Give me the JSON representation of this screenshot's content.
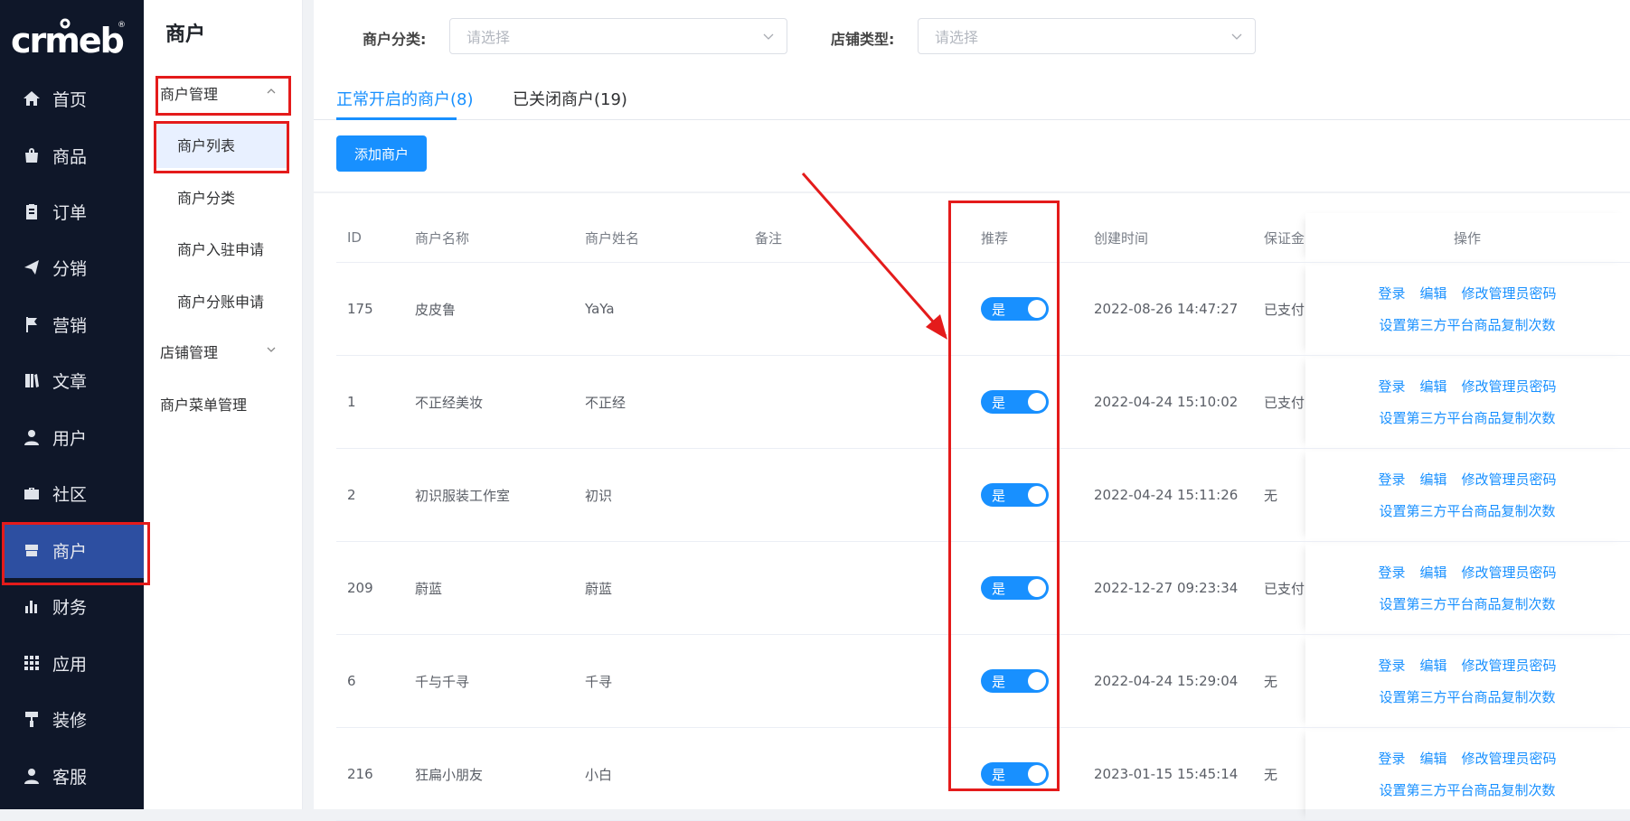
{
  "brand": {
    "logo_text": "crmeb"
  },
  "sidebar": {
    "items": [
      {
        "label": "首页",
        "icon": "home-icon"
      },
      {
        "label": "商品",
        "icon": "bag-icon"
      },
      {
        "label": "订单",
        "icon": "clipboard-icon"
      },
      {
        "label": "分销",
        "icon": "send-icon"
      },
      {
        "label": "营销",
        "icon": "flag-icon"
      },
      {
        "label": "文章",
        "icon": "book-icon"
      },
      {
        "label": "用户",
        "icon": "user-icon"
      },
      {
        "label": "社区",
        "icon": "briefcase-icon"
      },
      {
        "label": "商户",
        "icon": "store-icon",
        "active": true
      },
      {
        "label": "财务",
        "icon": "bar-chart-icon"
      },
      {
        "label": "应用",
        "icon": "grid-icon"
      },
      {
        "label": "装修",
        "icon": "paint-roller-icon"
      },
      {
        "label": "客服",
        "icon": "user-icon"
      }
    ]
  },
  "submenu": {
    "title": "商户",
    "group1": "商户管理",
    "items": [
      "商户列表",
      "商户分类",
      "商户入驻申请",
      "商户分账申请"
    ],
    "group2": "店铺管理",
    "item_menu": "商户菜单管理"
  },
  "filters": {
    "category_label": "商户分类:",
    "category_placeholder": "请选择",
    "type_label": "店铺类型:",
    "type_placeholder": "请选择"
  },
  "tabs": [
    {
      "label": "正常开启的商户(8)",
      "active": true
    },
    {
      "label": "已关闭商户(19)"
    }
  ],
  "add_button": "添加商户",
  "table": {
    "headers": [
      "ID",
      "商户名称",
      "商户姓名",
      "备注",
      "推荐",
      "创建时间",
      "保证金",
      "操作"
    ],
    "rows": [
      {
        "id": "175",
        "name": "皮皮鲁",
        "person": "YaYa",
        "note": "",
        "recommend": "是",
        "created": "2022-08-26 14:47:27",
        "deposit": "已支付"
      },
      {
        "id": "1",
        "name": "不正经美妆",
        "person": "不正经",
        "note": "",
        "recommend": "是",
        "created": "2022-04-24 15:10:02",
        "deposit": "已支付"
      },
      {
        "id": "2",
        "name": "初识服装工作室",
        "person": "初识",
        "note": "",
        "recommend": "是",
        "created": "2022-04-24 15:11:26",
        "deposit": "无"
      },
      {
        "id": "209",
        "name": "蔚蓝",
        "person": "蔚蓝",
        "note": "",
        "recommend": "是",
        "created": "2022-12-27 09:23:34",
        "deposit": "已支付"
      },
      {
        "id": "6",
        "name": "千与千寻",
        "person": "千寻",
        "note": "",
        "recommend": "是",
        "created": "2022-04-24 15:29:04",
        "deposit": "无"
      },
      {
        "id": "216",
        "name": "狂扁小朋友",
        "person": "小白",
        "note": "",
        "recommend": "是",
        "created": "2023-01-15 15:45:14",
        "deposit": "无"
      }
    ],
    "ops": {
      "login": "登录",
      "edit": "编辑",
      "change_pwd": "修改管理员密码",
      "copy_count": "设置第三方平台商品复制次数"
    }
  },
  "colors": {
    "sidebar_bg": "#0f1729",
    "sidebar_active": "#2d4fa1",
    "accent": "#1890ff",
    "annotation_red": "#e41b1b"
  }
}
